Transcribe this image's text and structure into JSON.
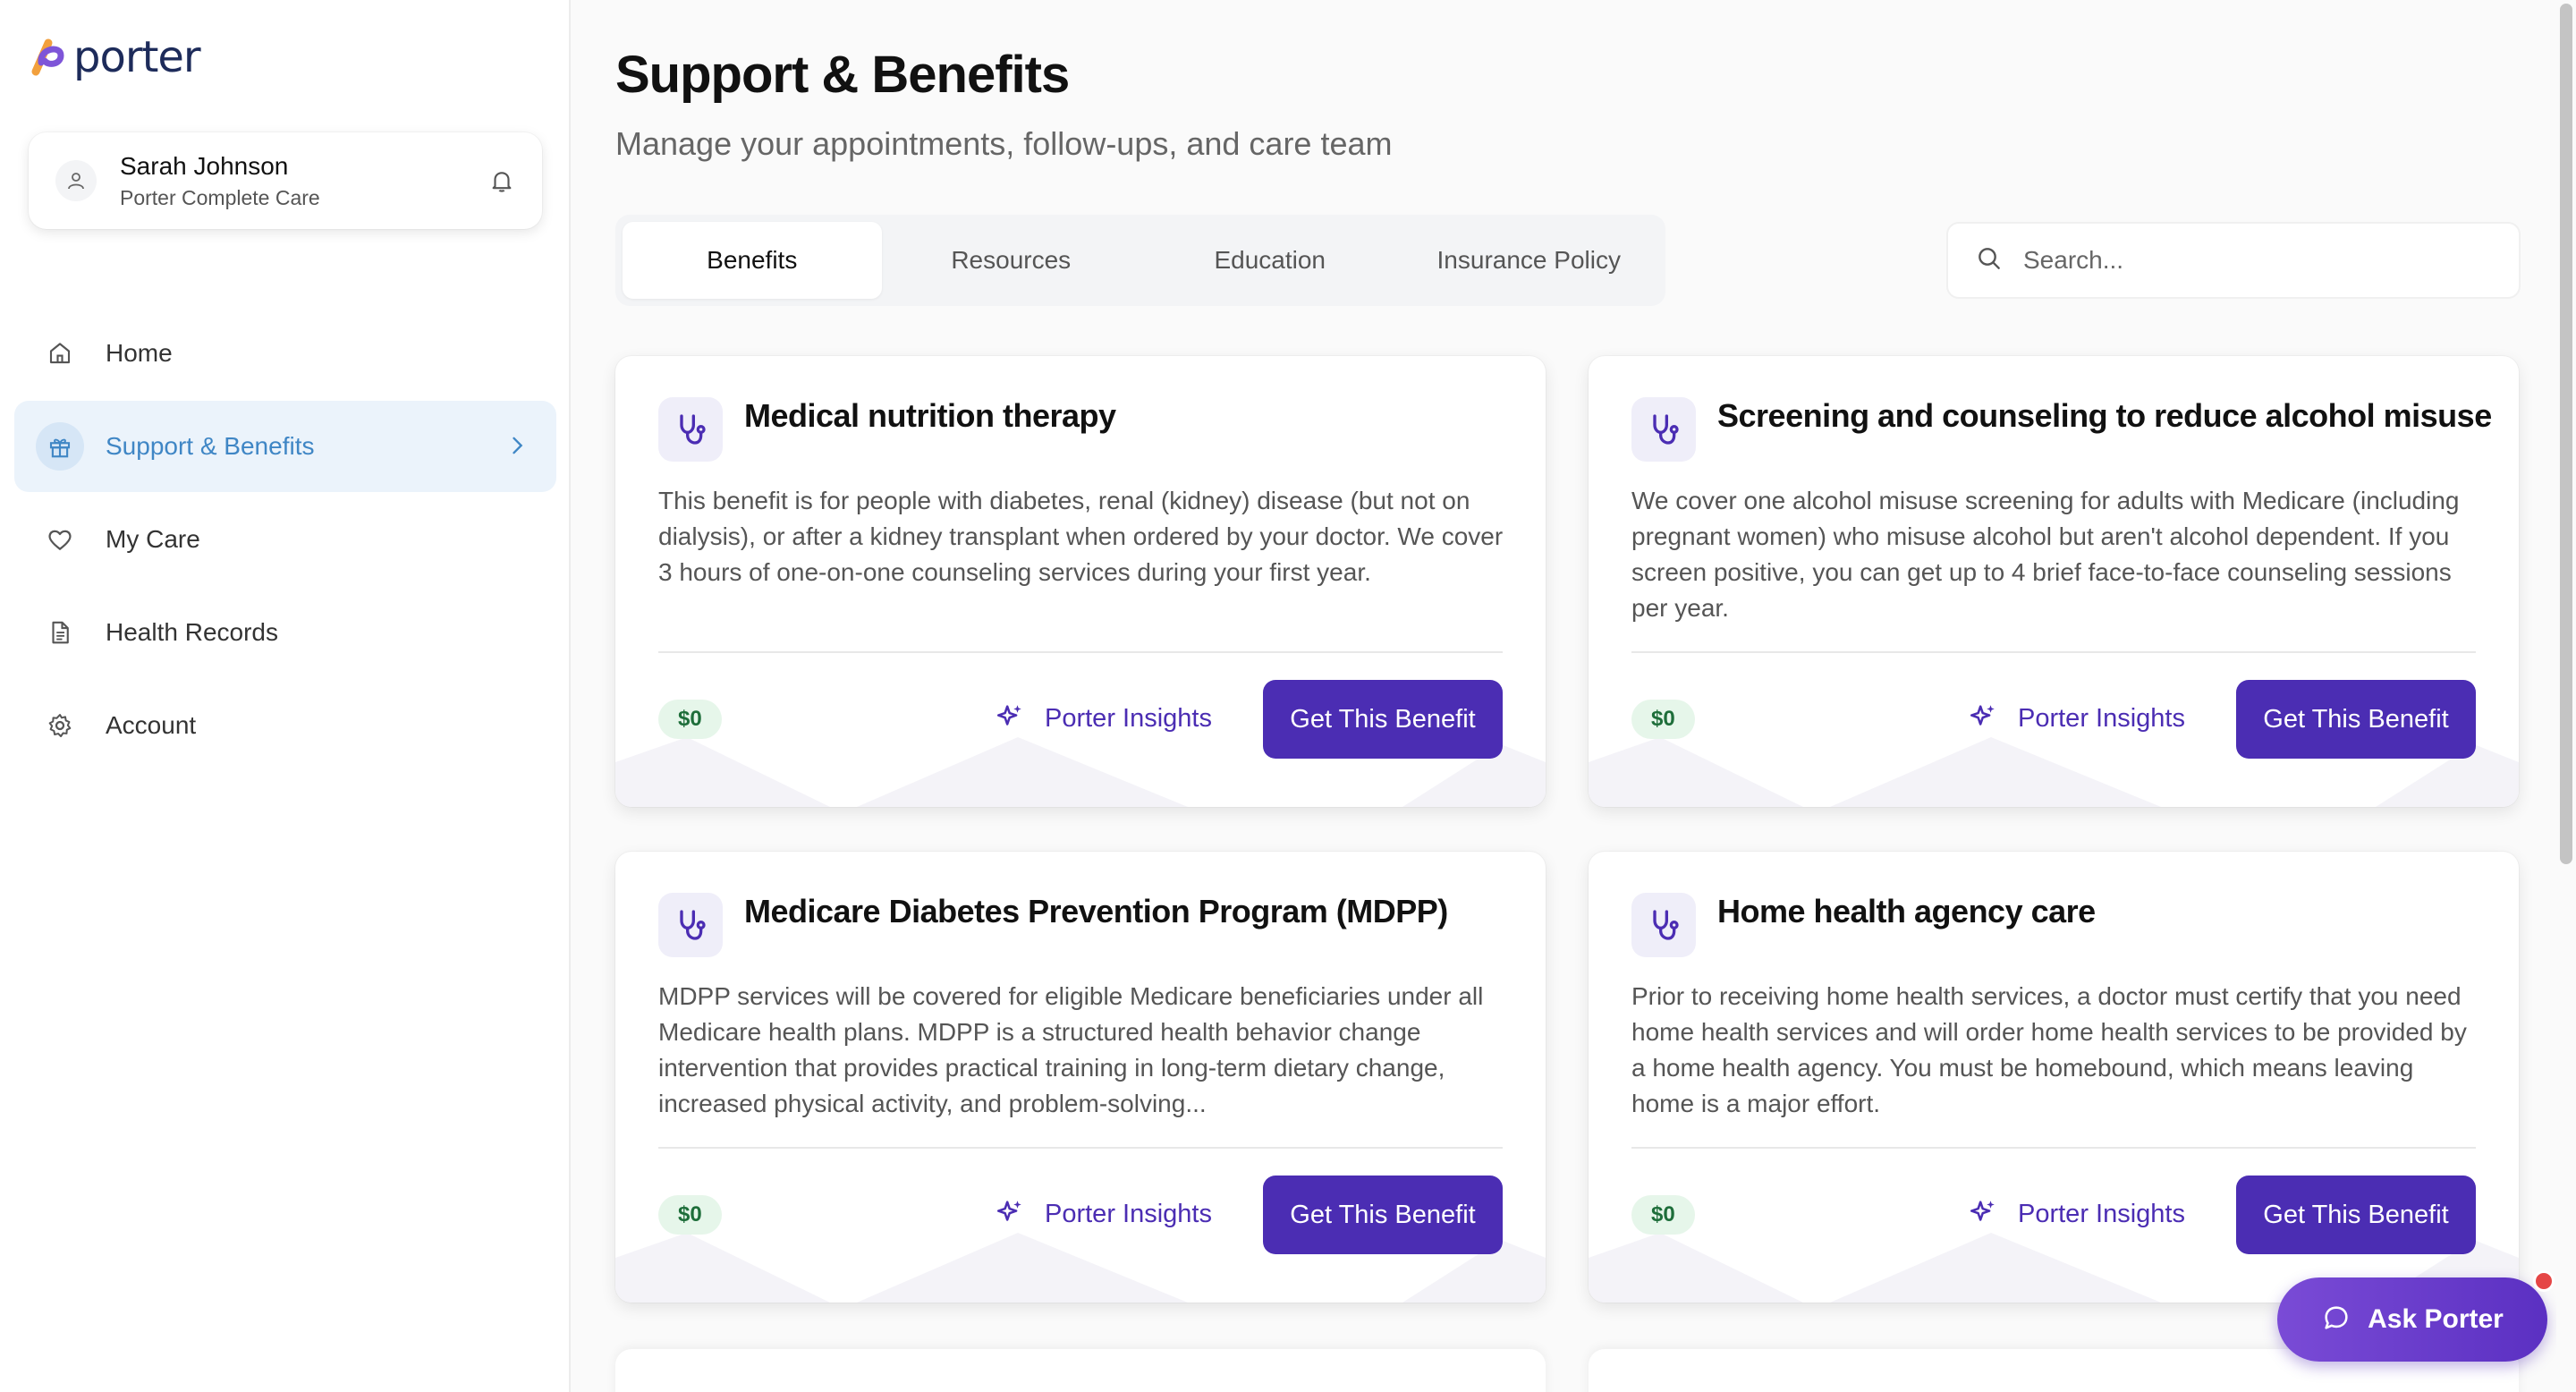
{
  "app": {
    "logo_text": "porter"
  },
  "user": {
    "name": "Sarah Johnson",
    "plan": "Porter Complete Care"
  },
  "sidebar": {
    "items": [
      {
        "label": "Home",
        "icon": "home-icon",
        "active": false
      },
      {
        "label": "Support & Benefits",
        "icon": "gift-icon",
        "active": true
      },
      {
        "label": "My Care",
        "icon": "heart-icon",
        "active": false
      },
      {
        "label": "Health Records",
        "icon": "document-icon",
        "active": false
      },
      {
        "label": "Account",
        "icon": "gear-icon",
        "active": false
      }
    ]
  },
  "header": {
    "title": "Support & Benefits",
    "subtitle": "Manage your appointments, follow-ups, and care team"
  },
  "tabs": [
    {
      "label": "Benefits",
      "active": true
    },
    {
      "label": "Resources",
      "active": false
    },
    {
      "label": "Education",
      "active": false
    },
    {
      "label": "Insurance Policy",
      "active": false
    }
  ],
  "search": {
    "placeholder": "Search...",
    "value": ""
  },
  "cards": [
    {
      "title": "Medical nutrition therapy",
      "description": "This benefit is for people with diabetes, renal (kidney) disease (but not on dialysis), or after a kidney transplant when ordered by your doctor. We cover 3 hours of one-on-one counseling services during your first year.",
      "price": "$0",
      "insights_label": "Porter Insights",
      "button_label": "Get This Benefit"
    },
    {
      "title": "Screening and counseling to reduce alcohol misuse",
      "description": "We cover one alcohol misuse screening for adults with Medicare (including pregnant women) who misuse alcohol but aren't alcohol dependent. If you screen positive, you can get up to 4 brief face-to-face counseling sessions per year.",
      "price": "$0",
      "insights_label": "Porter Insights",
      "button_label": "Get This Benefit"
    },
    {
      "title": "Medicare Diabetes Prevention Program (MDPP)",
      "description": "MDPP services will be covered for eligible Medicare beneficiaries under all Medicare health plans. MDPP is a structured health behavior change intervention that provides practical training in long-term dietary change, increased physical activity, and problem-solving...",
      "price": "$0",
      "insights_label": "Porter Insights",
      "button_label": "Get This Benefit"
    },
    {
      "title": "Home health agency care",
      "description": "Prior to receiving home health services, a doctor must certify that you need home health services and will order home health services to be provided by a home health agency. You must be homebound, which means leaving home is a major effort.",
      "price": "$0",
      "insights_label": "Porter Insights",
      "button_label": "Get This Benefit"
    }
  ],
  "assistant": {
    "label": "Ask Porter"
  },
  "colors": {
    "accent": "#4b2db3",
    "active_nav": "#3f86c5",
    "active_nav_bg": "#ebf3fb",
    "price_badge_bg": "#e6f6ea",
    "notification": "#e54646"
  }
}
